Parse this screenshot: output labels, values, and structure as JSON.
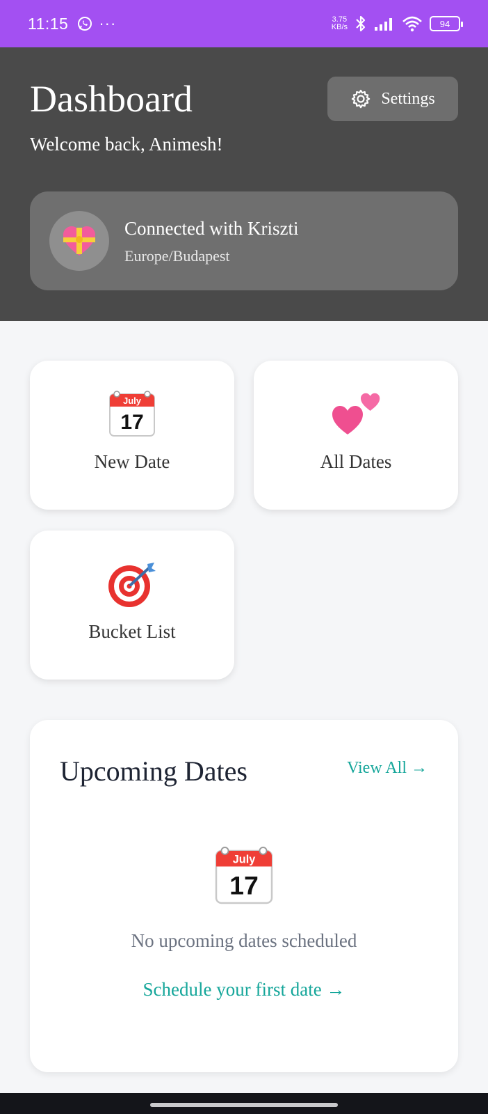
{
  "status_bar": {
    "time": "11:15",
    "more": "···",
    "net_speed_value": "3.75",
    "net_speed_unit": "KB/s",
    "battery": "94"
  },
  "header": {
    "title": "Dashboard",
    "welcome": "Welcome back, Animesh!",
    "settings_label": "Settings"
  },
  "partner": {
    "connected_text": "Connected with Kriszti",
    "timezone": "Europe/Budapest"
  },
  "tiles": [
    {
      "label": "New Date",
      "icon": "calendar-icon"
    },
    {
      "label": "All Dates",
      "icon": "two-hearts-icon"
    },
    {
      "label": "Bucket List",
      "icon": "target-icon"
    }
  ],
  "calendar_icon": {
    "month": "July",
    "day": "17"
  },
  "upcoming": {
    "title": "Upcoming Dates",
    "view_all": "View All →",
    "empty_text": "No upcoming dates scheduled",
    "cta": "Schedule your first date →"
  },
  "colors": {
    "status_bar": "#a350f2",
    "header_bg": "#4a4a4a",
    "accent": "#15a69a"
  }
}
